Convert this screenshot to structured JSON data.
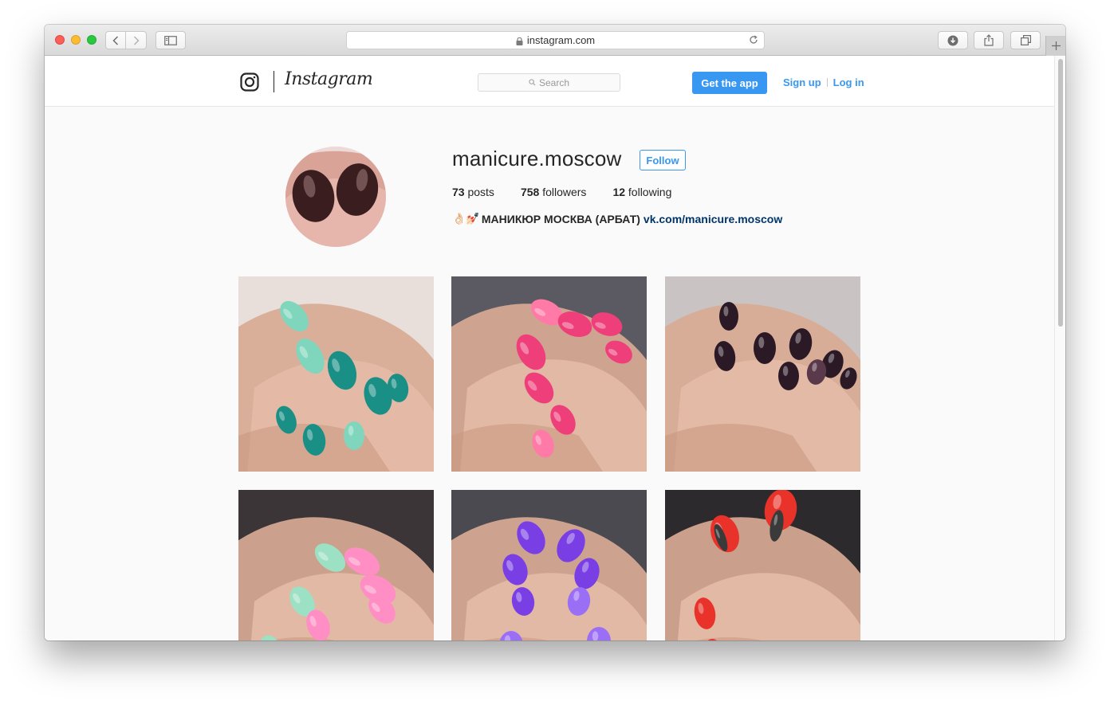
{
  "browser": {
    "url": "instagram.com",
    "back_icon": "chevron-left-icon",
    "forward_icon": "chevron-right-icon",
    "sidebar_icon": "sidebar-icon",
    "reload_icon": "reload-icon",
    "download_icon": "download-icon",
    "share_icon": "share-icon",
    "tabs_icon": "tabs-icon",
    "new_tab_icon": "plus-icon"
  },
  "header": {
    "wordmark": "Instagram",
    "search_placeholder": "Search",
    "get_app": "Get the app",
    "sign_up": "Sign up",
    "log_in": "Log in",
    "accent": "#3897f0"
  },
  "profile": {
    "username": "manicure.moscow",
    "follow": "Follow",
    "posts_count": "73",
    "posts_label": "posts",
    "followers_count": "758",
    "followers_label": "followers",
    "following_count": "12",
    "following_label": "following",
    "bio_emoji": "👌🏻💅🏻",
    "bio_name": "МАНИКЮР МОСКВА (АРБАТ)",
    "bio_link": "vk.com/manicure.moscow"
  },
  "posts": [
    {
      "nail_color": "#1a8f86",
      "accent": "#7fd6bc",
      "bg": "#e9dfda"
    },
    {
      "nail_color": "#ee3f7a",
      "accent": "#ff7aa6",
      "bg": "#5b5a63"
    },
    {
      "nail_color": "#2b1a26",
      "accent": "#5a3a4a",
      "bg": "#c9c4c3"
    },
    {
      "nail_color": "#ff8ec4",
      "accent": "#9de1c4",
      "bg": "#3b3537"
    },
    {
      "nail_color": "#7a3fe4",
      "accent": "#9b6ff5",
      "bg": "#4b4a50"
    },
    {
      "nail_color": "#e8322a",
      "accent": "#3a3a3a",
      "bg": "#2c2a2c"
    }
  ]
}
